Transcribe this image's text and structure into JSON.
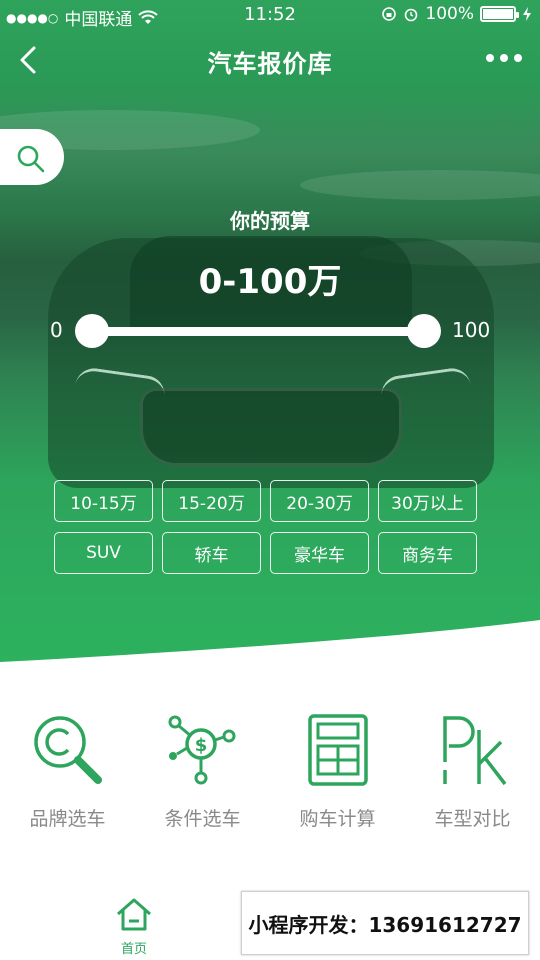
{
  "status_bar": {
    "carrier": "中国联通",
    "time": "11:52",
    "battery_percent": "100%",
    "battery_level": 1.0
  },
  "nav": {
    "title": "汽车报价库"
  },
  "budget": {
    "label": "你的预算",
    "value": "0-100万",
    "slider_min_label": "0",
    "slider_max_label": "100",
    "range_min": 0,
    "range_max": 100,
    "selected_min": 0,
    "selected_max": 100
  },
  "filters": {
    "price": [
      "10-15万",
      "15-20万",
      "20-30万",
      "30万以上"
    ],
    "type": [
      "SUV",
      "轿车",
      "豪华车",
      "商务车"
    ]
  },
  "features": [
    {
      "label": "品牌选车",
      "icon": "brand-search-icon"
    },
    {
      "label": "条件选车",
      "icon": "condition-network-icon"
    },
    {
      "label": "购车计算",
      "icon": "calculator-icon"
    },
    {
      "label": "车型对比",
      "icon": "pk-compare-icon"
    }
  ],
  "tab_bar": {
    "home_label": "首页"
  },
  "promo": {
    "text": "小程序开发：13691612727"
  },
  "colors": {
    "accent": "#2da55c",
    "label_gray": "#8a8a8a"
  }
}
